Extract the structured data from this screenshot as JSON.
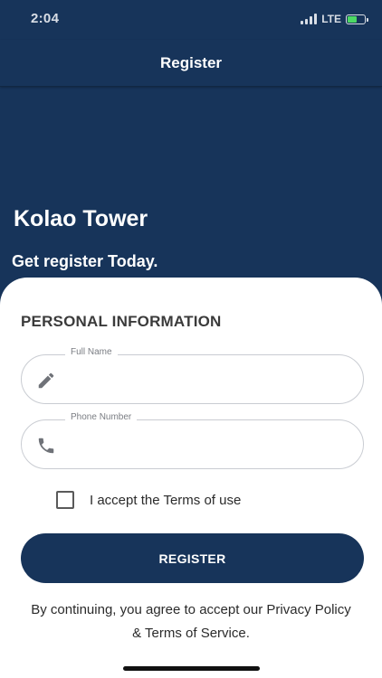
{
  "status_bar": {
    "time": "2:04",
    "network": "LTE",
    "battery_level": 0.55,
    "battery_color": "#4cd964"
  },
  "nav": {
    "title": "Register"
  },
  "hero": {
    "title": "Kolao Tower",
    "subtitle": "Get register Today."
  },
  "form": {
    "section_title": "PERSONAL INFORMATION",
    "full_name": {
      "label": "Full Name",
      "value": "",
      "icon": "pencil-icon"
    },
    "phone": {
      "label": "Phone Number",
      "value": "",
      "icon": "phone-icon"
    },
    "terms_checkbox": {
      "label": "I accept the Terms of use",
      "checked": false
    },
    "submit_label": "REGISTER"
  },
  "footer": {
    "line1": "By continuing, you agree to accept our Privacy Policy",
    "line2": "& Terms of Service."
  },
  "colors": {
    "brand": "#17345a",
    "card": "#ffffff",
    "border": "#c9ccd2"
  }
}
